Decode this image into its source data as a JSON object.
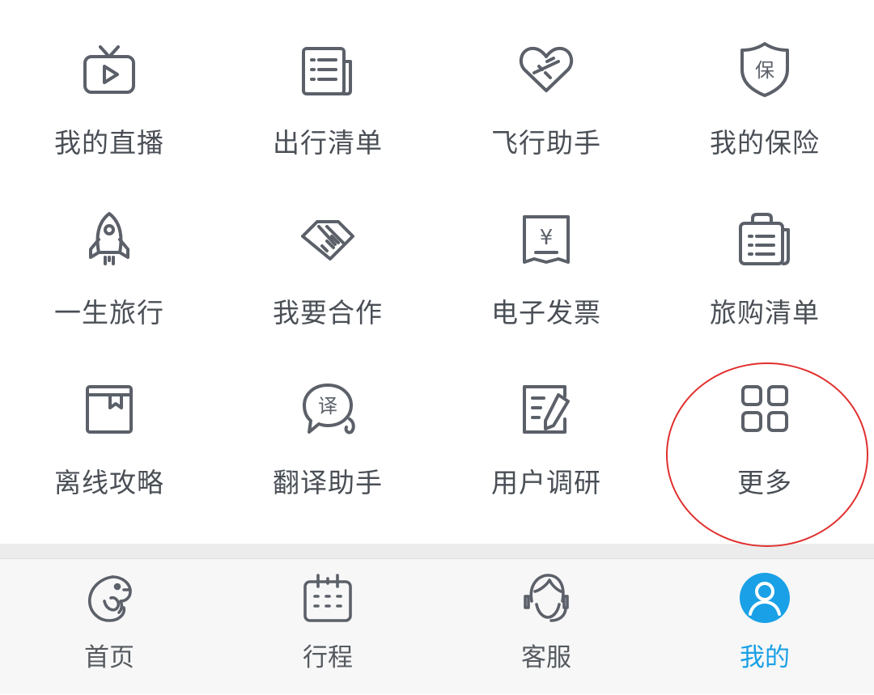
{
  "menu": {
    "items": [
      {
        "label": "我的直播",
        "icon": "tv-play-icon"
      },
      {
        "label": "出行清单",
        "icon": "checklist-document-icon"
      },
      {
        "label": "飞行助手",
        "icon": "heart-plane-icon"
      },
      {
        "label": "我的保险",
        "icon": "insurance-shield-icon",
        "badge": "保"
      },
      {
        "label": "一生旅行",
        "icon": "rocket-icon"
      },
      {
        "label": "我要合作",
        "icon": "handshake-icon"
      },
      {
        "label": "电子发票",
        "icon": "invoice-receipt-icon",
        "badge": "¥"
      },
      {
        "label": "旅购清单",
        "icon": "shopping-bag-list-icon"
      },
      {
        "label": "离线攻略",
        "icon": "offline-book-icon"
      },
      {
        "label": "翻译助手",
        "icon": "translate-bubble-icon",
        "badge": "译"
      },
      {
        "label": "用户调研",
        "icon": "survey-edit-icon"
      },
      {
        "label": "更多",
        "icon": "more-grid-icon"
      }
    ]
  },
  "tabbar": {
    "tabs": [
      {
        "label": "首页",
        "icon": "dolphin-home-icon",
        "active": false
      },
      {
        "label": "行程",
        "icon": "calendar-icon",
        "active": false
      },
      {
        "label": "客服",
        "icon": "customer-service-icon",
        "active": false
      },
      {
        "label": "我的",
        "icon": "user-profile-icon",
        "active": true
      }
    ]
  },
  "colors": {
    "icon_stroke": "#5b6069",
    "label": "#4a4f56",
    "active_tab": "#1aa0e6",
    "highlight_ring": "#e0302e",
    "separator": "#ececec"
  }
}
